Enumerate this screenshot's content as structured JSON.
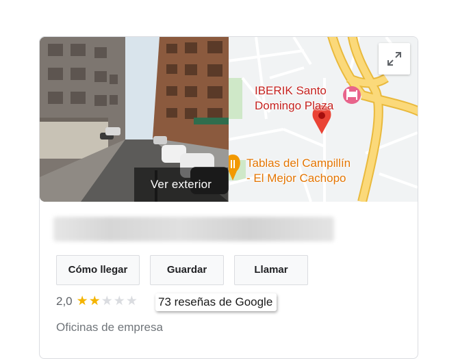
{
  "photo": {
    "label": "Ver exterior"
  },
  "map": {
    "place1_line1": "IBERIK Santo",
    "place1_line2": "Domingo Plaza",
    "place2_line1": "Tablas del Campillín",
    "place2_line2": "- El Mejor Cachopo",
    "expand_icon": "expand-icon"
  },
  "actions": {
    "directions": "Cómo llegar",
    "save": "Guardar",
    "call": "Llamar"
  },
  "rating": {
    "value": "2,0",
    "stars_filled": 2,
    "stars_total": 5,
    "reviews": "73 reseñas de Google"
  },
  "category": "Oficinas de empresa",
  "colors": {
    "star": "#f4b400",
    "road_major": "#fbd156",
    "pin": "#ea4335",
    "poi_red": "#c5221f",
    "poi_orange": "#e37400"
  }
}
